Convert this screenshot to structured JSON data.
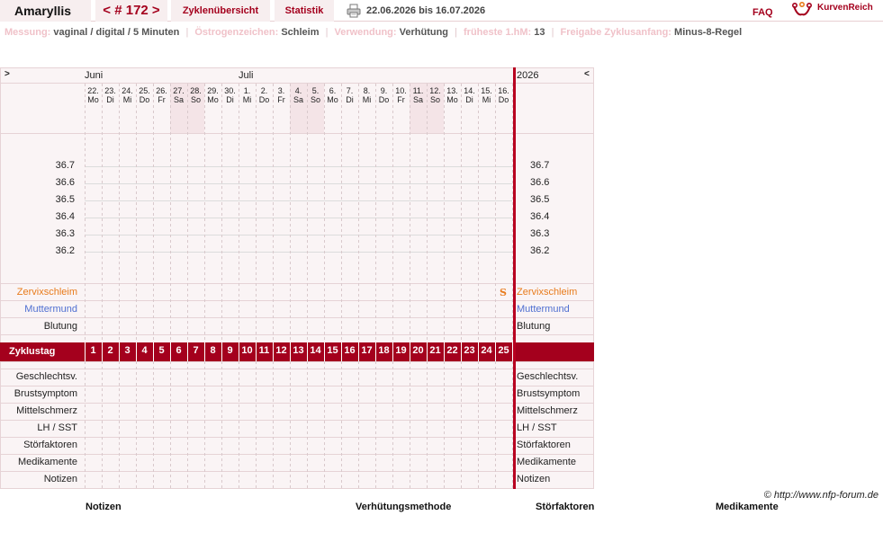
{
  "header": {
    "title": "Amaryllis",
    "cycle_nav": "< # 172 >",
    "overview_label": "Zyklenübersicht",
    "statistics_label": "Statistik",
    "date_range": "22.06.2026 bis 16.07.2026",
    "faq_label": "FAQ",
    "logo_text": "KurvenReich",
    "printer_icon": "printer-icon",
    "accent_color": "#a4001d"
  },
  "info": {
    "measurement_label": "Messung:",
    "measurement_value": "vaginal / digital / 5 Minuten",
    "estrogen_label": "Östrogenzeichen:",
    "estrogen_value": "Schleim",
    "usage_label": "Verwendung:",
    "usage_value": "Verhütung",
    "earliest_label": "früheste 1.hM:",
    "earliest_value": "13",
    "release_label": "Freigabe Zyklusanfang:",
    "release_value": "Minus-8-Regel"
  },
  "chart": {
    "nav_prev": ">",
    "nav_next": "<",
    "year": "2026",
    "months": [
      {
        "label": "Juni",
        "day_index": 0
      },
      {
        "label": "Juli",
        "day_index": 9
      }
    ],
    "days": [
      {
        "date": "22.",
        "weekday": "Mo",
        "cycle_day": "1",
        "weekend": false
      },
      {
        "date": "23.",
        "weekday": "Di",
        "cycle_day": "2",
        "weekend": false
      },
      {
        "date": "24.",
        "weekday": "Mi",
        "cycle_day": "3",
        "weekend": false
      },
      {
        "date": "25.",
        "weekday": "Do",
        "cycle_day": "4",
        "weekend": false
      },
      {
        "date": "26.",
        "weekday": "Fr",
        "cycle_day": "5",
        "weekend": false
      },
      {
        "date": "27.",
        "weekday": "Sa",
        "cycle_day": "6",
        "weekend": true
      },
      {
        "date": "28.",
        "weekday": "So",
        "cycle_day": "7",
        "weekend": true
      },
      {
        "date": "29.",
        "weekday": "Mo",
        "cycle_day": "8",
        "weekend": false
      },
      {
        "date": "30.",
        "weekday": "Di",
        "cycle_day": "9",
        "weekend": false
      },
      {
        "date": "1.",
        "weekday": "Mi",
        "cycle_day": "10",
        "weekend": false
      },
      {
        "date": "2.",
        "weekday": "Do",
        "cycle_day": "11",
        "weekend": false
      },
      {
        "date": "3.",
        "weekday": "Fr",
        "cycle_day": "12",
        "weekend": false
      },
      {
        "date": "4.",
        "weekday": "Sa",
        "cycle_day": "13",
        "weekend": true
      },
      {
        "date": "5.",
        "weekday": "So",
        "cycle_day": "14",
        "weekend": true
      },
      {
        "date": "6.",
        "weekday": "Mo",
        "cycle_day": "15",
        "weekend": false
      },
      {
        "date": "7.",
        "weekday": "Di",
        "cycle_day": "16",
        "weekend": false
      },
      {
        "date": "8.",
        "weekday": "Mi",
        "cycle_day": "17",
        "weekend": false
      },
      {
        "date": "9.",
        "weekday": "Do",
        "cycle_day": "18",
        "weekend": false
      },
      {
        "date": "10.",
        "weekday": "Fr",
        "cycle_day": "19",
        "weekend": false
      },
      {
        "date": "11.",
        "weekday": "Sa",
        "cycle_day": "20",
        "weekend": true
      },
      {
        "date": "12.",
        "weekday": "So",
        "cycle_day": "21",
        "weekend": true
      },
      {
        "date": "13.",
        "weekday": "Mo",
        "cycle_day": "22",
        "weekend": false
      },
      {
        "date": "14.",
        "weekday": "Di",
        "cycle_day": "23",
        "weekend": false
      },
      {
        "date": "15.",
        "weekday": "Mi",
        "cycle_day": "24",
        "weekend": false
      },
      {
        "date": "16.",
        "weekday": "Do",
        "cycle_day": "25",
        "weekend": false
      }
    ],
    "temperatures": [
      "36.7",
      "36.6",
      "36.5",
      "36.4",
      "36.3",
      "36.2"
    ],
    "cervical_mucus_label": "Zervixschleim",
    "cervix_label": "Muttermund",
    "bleeding_label": "Blutung",
    "cycle_day_label": "Zyklustag",
    "mucus_marker": "S",
    "mucus_marker_day_index": 24,
    "bottom_rows": [
      "Geschlechtsv.",
      "Brustsymptom",
      "Mittelschmerz",
      "LH / SST",
      "Störfaktoren",
      "Medikamente",
      "Notizen"
    ],
    "weekend_color": "#f4e4e7",
    "cycleday_band_color": "#a4001d",
    "mucus_color": "#e87b1c",
    "cervix_color": "#4f6fd1"
  },
  "footer": {
    "copyright": "© http://www.nfp-forum.de",
    "notes_title": "Notizen",
    "contraception_title": "Verhütungsmethode",
    "disturbance_title": "Störfaktoren",
    "medication_title": "Medikamente"
  }
}
